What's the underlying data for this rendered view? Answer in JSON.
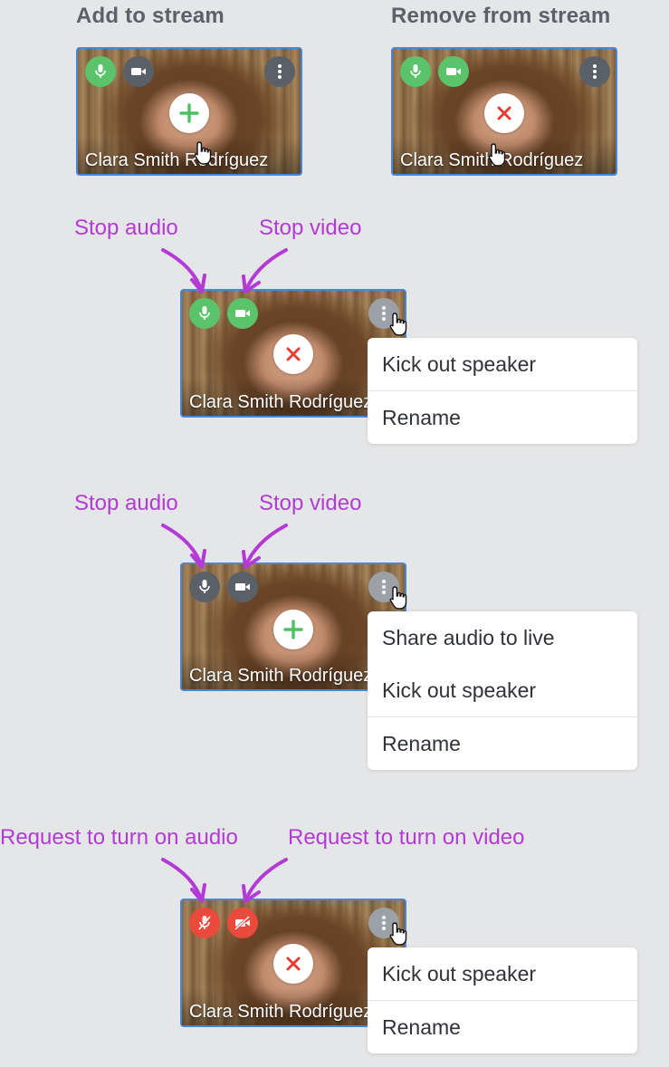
{
  "headings": {
    "add": "Add to stream",
    "remove": "Remove from stream"
  },
  "speaker_name": "Clara Smith Rodríguez",
  "annotations": {
    "stop_audio": "Stop audio",
    "stop_video": "Stop video",
    "request_audio": "Request to turn on audio",
    "request_video": "Request to turn on video"
  },
  "menus": {
    "menu1": [
      "Kick out speaker",
      "Rename"
    ],
    "menu2": [
      "Share audio to live",
      "Kick out speaker",
      "Rename"
    ],
    "menu3": [
      "Kick out speaker",
      "Rename"
    ]
  },
  "colors": {
    "active_green": "#5bc46b",
    "inactive_dark": "#5a6068",
    "muted_red": "#ea4a3c",
    "annotation_purple": "#b43ad6",
    "tile_border": "#4a86d6"
  },
  "icons": [
    "mic-icon",
    "video-camera-icon",
    "more-vertical-icon",
    "plus-icon",
    "close-icon",
    "hand-cursor-icon",
    "mic-off-icon",
    "video-off-icon"
  ]
}
